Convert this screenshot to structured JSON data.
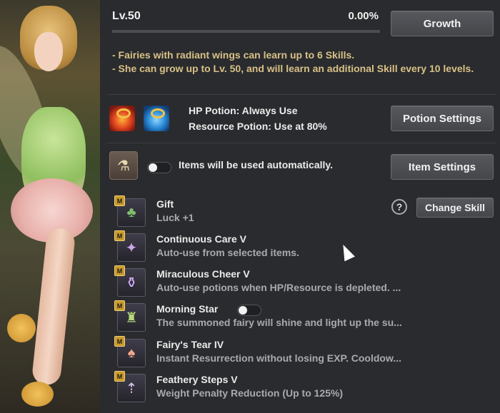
{
  "header": {
    "level": "Lv.50",
    "progress_text": "0.00%",
    "progress": 0.0,
    "growth_label": "Growth"
  },
  "description": [
    "- Fairies with radiant wings can learn up to 6 Skills.",
    "- She can grow up to Lv. 50, and will learn an additional Skill every 10 levels."
  ],
  "potions": {
    "hp": "HP Potion: Always Use",
    "resource": "Resource Potion: Use at 80%",
    "settings_label": "Potion Settings"
  },
  "items": {
    "auto_text": "Items will be used automatically.",
    "settings_label": "Item Settings"
  },
  "skills_header": {
    "help": "?",
    "change_label": "Change Skill"
  },
  "skills": [
    {
      "badge": "M",
      "icon": "clover-icon",
      "name": "Gift",
      "desc": "Luck +1"
    },
    {
      "badge": "M",
      "icon": "fairy-icon",
      "name": "Continuous Care V",
      "desc": "Auto-use from selected items."
    },
    {
      "badge": "M",
      "icon": "potion-icon",
      "name": "Miraculous Cheer V",
      "desc": "Auto-use potions when HP/Resource is depleted. ..."
    },
    {
      "badge": "M",
      "icon": "lantern-icon",
      "name": "Morning Star",
      "desc": "The summoned fairy will shine and light up the su..."
    },
    {
      "badge": "M",
      "icon": "tear-vial-icon",
      "name": "Fairy's Tear IV",
      "desc": "Instant Resurrection without losing EXP. Cooldow..."
    },
    {
      "badge": "M",
      "icon": "feather-weight-icon",
      "name": "Feathery Steps V",
      "desc": "Weight Penalty Reduction (Up to 125%)"
    }
  ],
  "colors": {
    "accent_text": "#d8c187",
    "panel_bg": "#2a2b2e",
    "badge": "#c99b2c"
  }
}
